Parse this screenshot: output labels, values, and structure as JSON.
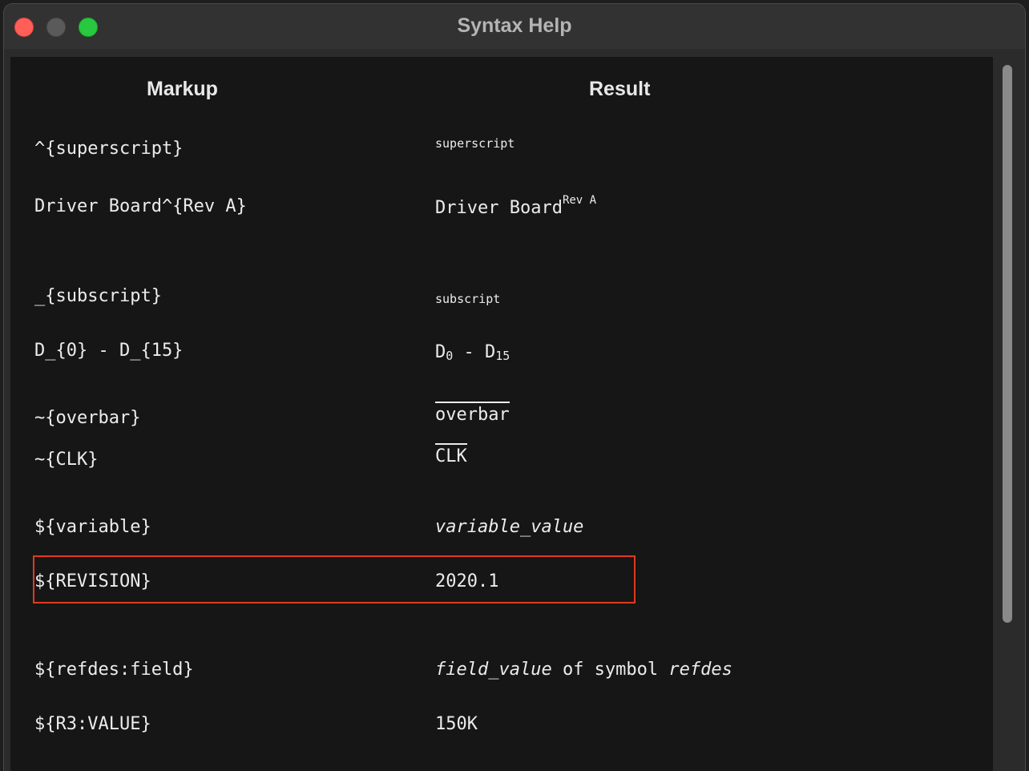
{
  "window": {
    "title": "Syntax Help",
    "colors": {
      "close": "#ff5f57",
      "minimize": "#5a5a5a",
      "maximize": "#28c840",
      "highlight": "#e03a1e"
    }
  },
  "table": {
    "headers": {
      "markup": "Markup",
      "result": "Result"
    },
    "rows": {
      "superscript": {
        "markup": "^{superscript}",
        "result": "superscript"
      },
      "superscript_example": {
        "markup": "Driver Board^{Rev A}",
        "result_base": "Driver Board",
        "result_sup": "Rev A"
      },
      "subscript": {
        "markup": "_{subscript}",
        "result": "subscript"
      },
      "subscript_example": {
        "markup": "D_{0} - D_{15}",
        "r1": "D",
        "s1": "0",
        "mid": " - ",
        "r2": "D",
        "s2": "15"
      },
      "overbar": {
        "markup": "~{overbar}",
        "result": "overbar"
      },
      "overbar_example": {
        "markup": "~{CLK}",
        "result": "CLK"
      },
      "variable": {
        "markup": "${variable}",
        "result": "variable_value"
      },
      "variable_example": {
        "markup": "${REVISION}",
        "result": "2020.1"
      },
      "field": {
        "markup": "${refdes:field}",
        "r1": "field_value",
        "r2": " of symbol ",
        "r3": "refdes"
      },
      "field_example": {
        "markup": "${R3:VALUE}",
        "result": "150K"
      }
    }
  }
}
